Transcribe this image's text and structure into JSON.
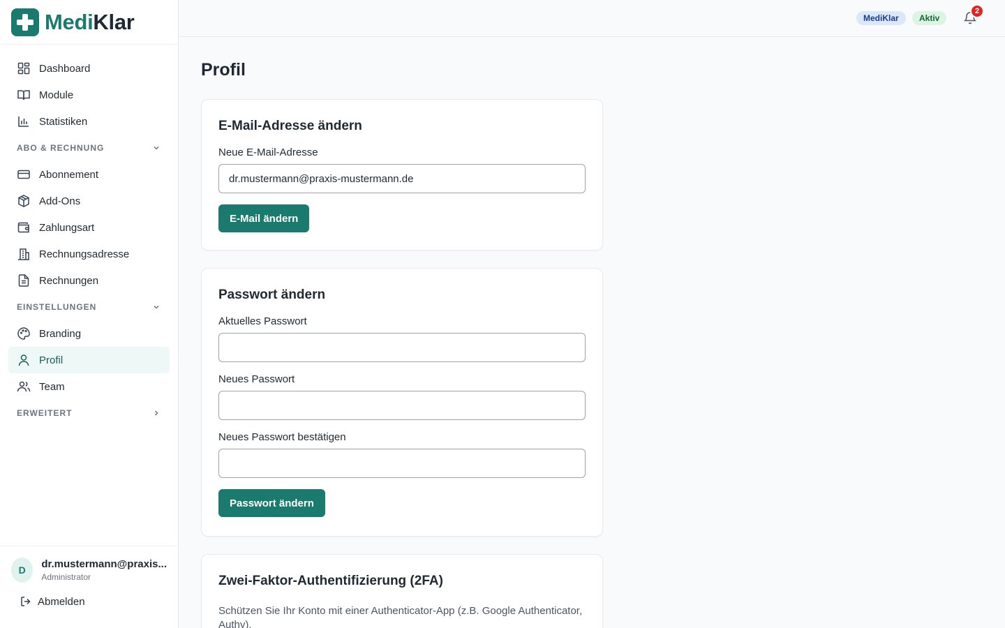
{
  "brand": {
    "name_part1": "Medi",
    "name_part2": "Klar"
  },
  "nav": {
    "items_top": [
      {
        "label": "Dashboard",
        "icon": "dashboard-icon"
      },
      {
        "label": "Module",
        "icon": "book-icon"
      },
      {
        "label": "Statistiken",
        "icon": "bar-chart-icon"
      }
    ],
    "section_billing": "ABO & RECHNUNG",
    "items_billing": [
      {
        "label": "Abonnement",
        "icon": "credit-card-icon"
      },
      {
        "label": "Add-Ons",
        "icon": "package-icon"
      },
      {
        "label": "Zahlungsart",
        "icon": "wallet-icon"
      },
      {
        "label": "Rechnungsadresse",
        "icon": "building-icon"
      },
      {
        "label": "Rechnungen",
        "icon": "document-icon"
      }
    ],
    "section_settings": "EINSTELLUNGEN",
    "items_settings": [
      {
        "label": "Branding",
        "icon": "palette-icon"
      },
      {
        "label": "Profil",
        "icon": "user-icon",
        "active": true
      },
      {
        "label": "Team",
        "icon": "users-icon"
      }
    ],
    "section_advanced": "ERWEITERT"
  },
  "user": {
    "initial": "D",
    "email": "dr.mustermann@praxis...",
    "role": "Administrator",
    "logout_label": "Abmelden"
  },
  "topbar": {
    "brand_badge": "MediKlar",
    "status_badge": "Aktiv",
    "notification_count": "2"
  },
  "page": {
    "title": "Profil"
  },
  "email_card": {
    "title": "E-Mail-Adresse ändern",
    "field_label": "Neue E-Mail-Adresse",
    "field_value": "dr.mustermann@praxis-mustermann.de",
    "button": "E-Mail ändern"
  },
  "password_card": {
    "title": "Passwort ändern",
    "current_label": "Aktuelles Passwort",
    "new_label": "Neues Passwort",
    "confirm_label": "Neues Passwort bestätigen",
    "button": "Passwort ändern"
  },
  "twofa_card": {
    "title": "Zwei-Faktor-Authentifizierung (2FA)",
    "description": "Schützen Sie Ihr Konto mit einer Authenticator-App (z.B. Google Authenticator, Authy)."
  },
  "colors": {
    "accent": "#1b7a6e",
    "active_nav_bg": "#eef8f6",
    "notification": "#e02424"
  }
}
